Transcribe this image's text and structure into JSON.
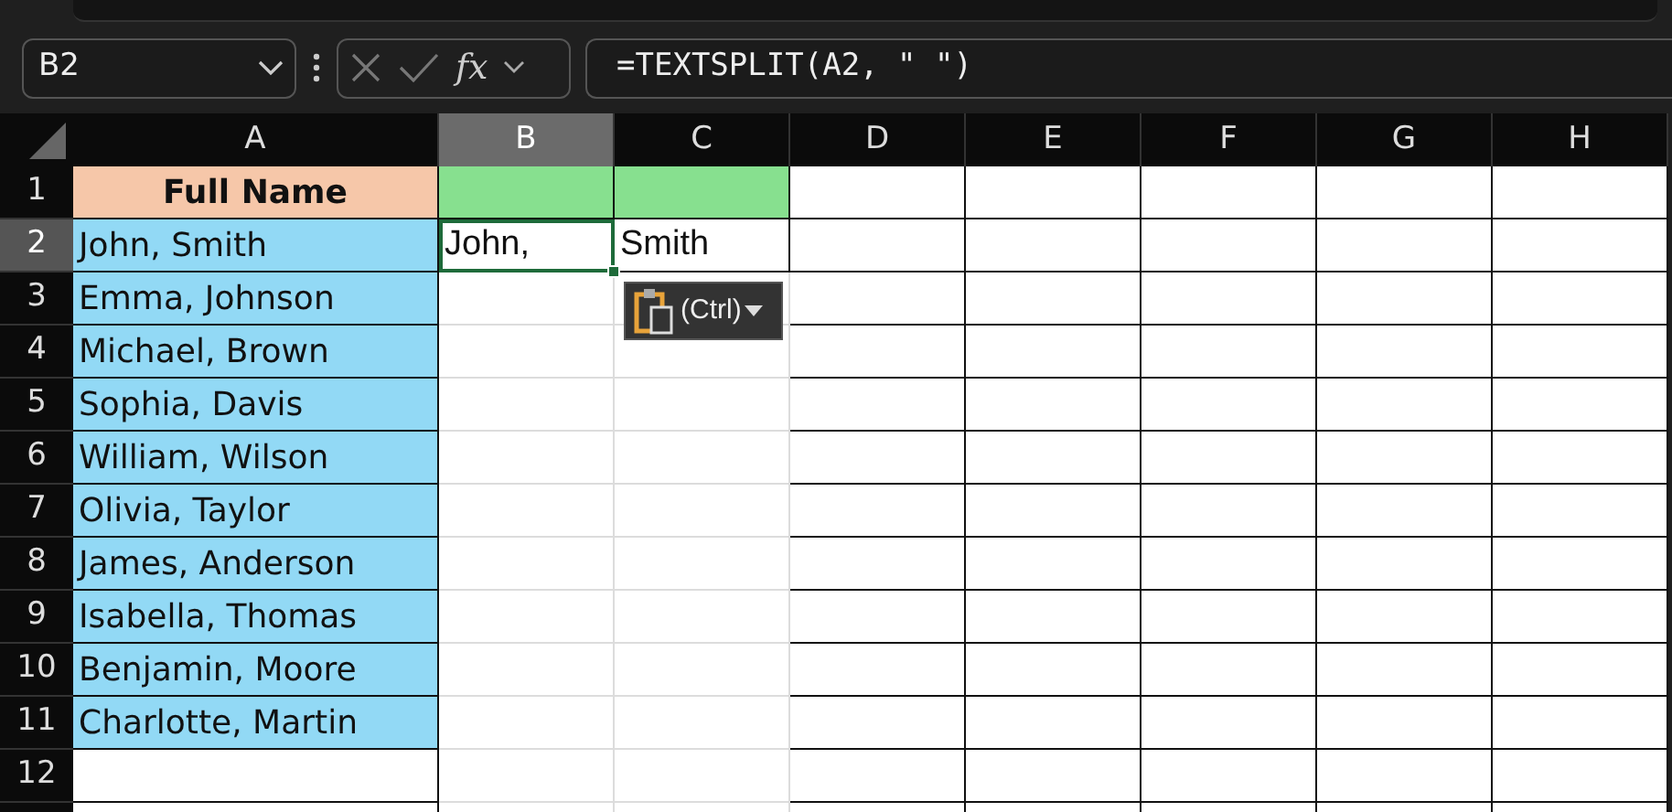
{
  "name_box": "B2",
  "formula_bar": {
    "formula": "=TEXTSPLIT(A2, \" \")",
    "fx": "fx"
  },
  "columns": [
    {
      "label": "A",
      "selected": false
    },
    {
      "label": "B",
      "selected": true
    },
    {
      "label": "C",
      "selected": false
    },
    {
      "label": "D",
      "selected": false
    },
    {
      "label": "E",
      "selected": false
    },
    {
      "label": "F",
      "selected": false
    },
    {
      "label": "G",
      "selected": false
    },
    {
      "label": "H",
      "selected": false
    }
  ],
  "rows": [
    {
      "number": "1",
      "selected": false,
      "cells": [
        {
          "text": "Full Name",
          "bold": true,
          "color": "#f6c7a9"
        },
        {
          "color": "#87e08f"
        },
        {
          "color": "#87e08f"
        },
        {},
        {},
        {},
        {},
        {}
      ]
    },
    {
      "number": "2",
      "selected": true,
      "cells": [
        {
          "text": "John, Smith",
          "color": "#92d9f5"
        },
        {
          "text": "John,"
        },
        {
          "text": "Smith"
        },
        {},
        {},
        {},
        {},
        {}
      ]
    },
    {
      "number": "3",
      "selected": false,
      "cells": [
        {
          "text": "Emma, Johnson",
          "color": "#92d9f5"
        },
        {},
        {},
        {},
        {},
        {},
        {},
        {}
      ]
    },
    {
      "number": "4",
      "selected": false,
      "cells": [
        {
          "text": "Michael, Brown",
          "color": "#92d9f5"
        },
        {},
        {},
        {},
        {},
        {},
        {},
        {}
      ]
    },
    {
      "number": "5",
      "selected": false,
      "cells": [
        {
          "text": "Sophia, Davis",
          "color": "#92d9f5"
        },
        {},
        {},
        {},
        {},
        {},
        {},
        {}
      ]
    },
    {
      "number": "6",
      "selected": false,
      "cells": [
        {
          "text": "William, Wilson",
          "color": "#92d9f5"
        },
        {},
        {},
        {},
        {},
        {},
        {},
        {}
      ]
    },
    {
      "number": "7",
      "selected": false,
      "cells": [
        {
          "text": "Olivia, Taylor",
          "color": "#92d9f5"
        },
        {},
        {},
        {},
        {},
        {},
        {},
        {}
      ]
    },
    {
      "number": "8",
      "selected": false,
      "cells": [
        {
          "text": "James, Anderson",
          "color": "#92d9f5"
        },
        {},
        {},
        {},
        {},
        {},
        {},
        {}
      ]
    },
    {
      "number": "9",
      "selected": false,
      "cells": [
        {
          "text": "Isabella, Thomas",
          "color": "#92d9f5"
        },
        {},
        {},
        {},
        {},
        {},
        {},
        {}
      ]
    },
    {
      "number": "10",
      "selected": false,
      "cells": [
        {
          "text": "Benjamin, Moore",
          "color": "#92d9f5"
        },
        {},
        {},
        {},
        {},
        {},
        {},
        {}
      ]
    },
    {
      "number": "11",
      "selected": false,
      "cells": [
        {
          "text": "Charlotte, Martin",
          "color": "#92d9f5"
        },
        {},
        {},
        {},
        {},
        {},
        {},
        {}
      ]
    },
    {
      "number": "12",
      "selected": false,
      "cells": [
        {},
        {},
        {},
        {},
        {},
        {},
        {},
        {}
      ]
    }
  ],
  "paste_options": {
    "label": "(Ctrl)"
  }
}
